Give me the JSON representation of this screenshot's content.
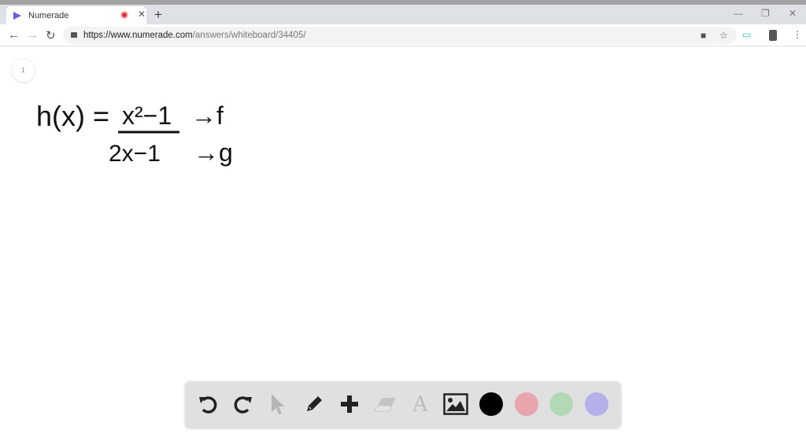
{
  "browser": {
    "tab_title": "Numerade",
    "url_host": "https://www.numerade.com",
    "url_path": "/answers/whiteboard/34405/"
  },
  "whiteboard": {
    "page_number": "1",
    "lines": [
      {
        "lhs": "h(x) =",
        "numerator": "x²−1",
        "note": "→f"
      },
      {
        "denominator": "2x−1",
        "note": "→g"
      }
    ]
  },
  "toolbar": {
    "tools": [
      "undo-icon",
      "redo-icon",
      "select-icon",
      "pencil-icon",
      "add-icon",
      "eraser-icon",
      "text-icon",
      "image-icon"
    ],
    "colors": [
      "#000000",
      "#e8a5ab",
      "#b2d8b5",
      "#b3b0ea"
    ]
  }
}
